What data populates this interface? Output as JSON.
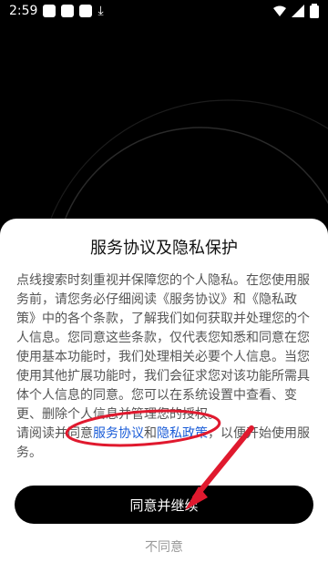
{
  "status": {
    "time": "2:59"
  },
  "dialog": {
    "title": "服务协议及隐私保护",
    "text_main": "点线搜索时刻重视并保障您的个人隐私。在您使用服务前，请您务必仔细阅读《服务协议》和《隐私政策》中的各个条款，了解我们如何获取并处理您的个人信息。您同意这些条款，仅代表您知悉和同意在您使用基本功能时，我们处理相关必要个人信息。当您使用其他扩展功能时，我们会征求您对该功能所需具体个人信息的同意。您可以在系统设置中查看、变更、删除个人信息并管理您的授权。",
    "text_prefix": "请阅读并同意",
    "link_terms": "服务协议",
    "and": "和",
    "link_privacy": "隐私政策",
    "text_suffix": "，以便开始使用服务。",
    "agree_button": "同意并继续",
    "disagree_button": "不同意"
  },
  "colors": {
    "link": "#1b5dd8",
    "annotation": "#e0192e"
  }
}
